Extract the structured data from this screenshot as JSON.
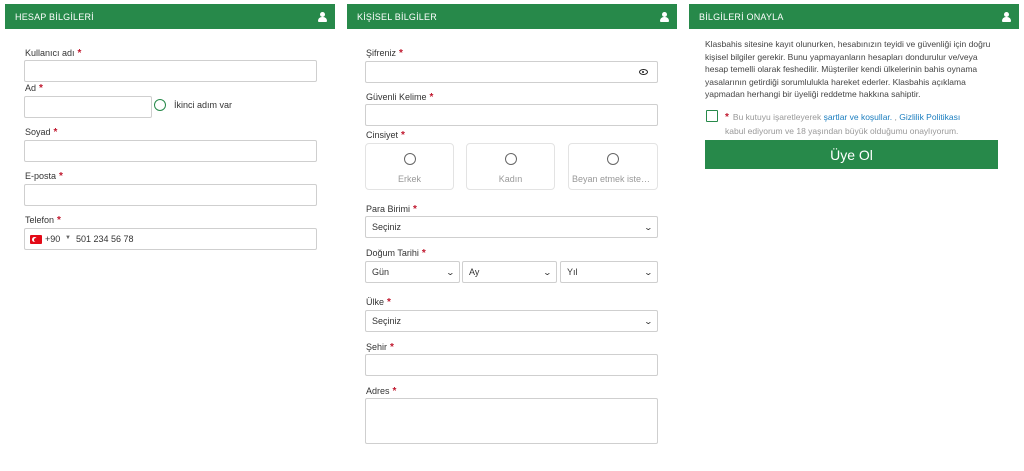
{
  "account": {
    "title": "HESAP BİLGİLERİ",
    "username_label": "Kullanıcı adı",
    "name_label": "Ad",
    "two_factor_label": "İkinci adım var",
    "surname_label": "Soyad",
    "email_label": "E-posta",
    "phone_label": "Telefon",
    "phone_code": "+90",
    "phone_placeholder": "501 234 56 78",
    "required_mark": "*"
  },
  "personal": {
    "title": "KİŞİSEL BİLGİLER",
    "password_label": "Şifreniz",
    "security_word_label": "Güvenli Kelime",
    "gender_label": "Cinsiyet",
    "gender_options": [
      "Erkek",
      "Kadın",
      "Beyan etmek istem..."
    ],
    "currency_label": "Para Birimi",
    "currency_value": "Seçiniz",
    "birthdate_label": "Doğum Tarihi",
    "day_value": "Gün",
    "month_value": "Ay",
    "year_value": "Yıl",
    "country_label": "Ülke",
    "country_value": "Seçiniz",
    "city_label": "Şehir",
    "address_label": "Adres",
    "required_mark": "*"
  },
  "confirm": {
    "title": "BİLGİLERİ ONAYLA",
    "notice": "Klasbahis sitesine kayıt olunurken, hesabınızın teyidi ve güvenliği için doğru kişisel bilgiler gerekir. Bunu yapmayanların hesapları dondurulur ve/veya hesap temelli olarak feshedilir. Müşteriler kendi ülkelerinin bahis oynama yasalarının getirdiği sorumlulukla hareket ederler. Klasbahis açıklama yapmadan herhangi bir üyeliği reddetme hakkına sahiptir.",
    "consent_prefix": "Bu kutuyu işaretleyerek",
    "terms_link": "şartlar ve koşullar.",
    "separator": ",",
    "privacy_link": "Gizlilik Politikası",
    "consent_suffix": "kabul ediyorum ve 18 yaşından büyük olduğumu onaylıyorum.",
    "submit_label": "Üye Ol",
    "required_mark": "*"
  },
  "colors": {
    "brand_green": "#27894a",
    "required_red": "#c0182e",
    "link_blue": "#1a7dbf"
  },
  "icons": {
    "panel_header": "user-icon",
    "password_toggle": "eye-icon",
    "flag": "turkey-flag-icon"
  }
}
